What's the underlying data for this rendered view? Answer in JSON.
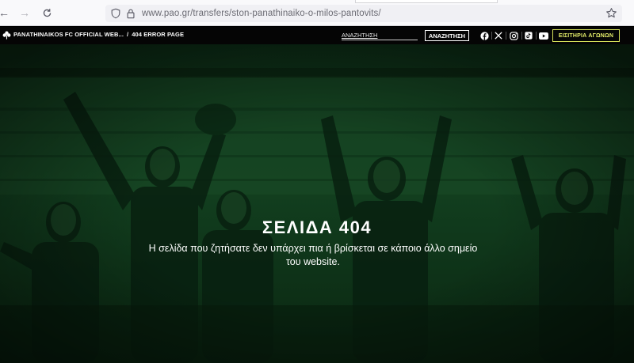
{
  "browser": {
    "url_host": "www.pao.gr",
    "url_path": "/transfers/ston-panathinaiko-o-milos-pantovits/"
  },
  "header": {
    "site_name": "PANATHINAIKOS FC OFFICIAL WEB...",
    "separator": "/",
    "current_page": "404 ERROR PAGE",
    "search_placeholder": "ΑΝΑΖΗΤΗΣΗ",
    "search_button": "ΑΝΑΖΗΤΗΣΗ",
    "social": [
      "facebook-icon",
      "x-icon",
      "instagram-icon",
      "tiktok-icon",
      "youtube-icon"
    ],
    "tickets_button": "ΕΙΣΙΤΗΡΙΑ ΑΓΩΝΩΝ"
  },
  "hero": {
    "title": "ΣΕΛΙΔΑ 404",
    "message": "Η σελίδα που ζητήσατε δεν υπάρχει πια ή βρίσκεται σε κάποιο άλλο σημείο του website."
  },
  "colors": {
    "hero_tint": "#0f3a1c",
    "header_bg": "#050505",
    "tickets_accent": "#e6ef6a"
  }
}
